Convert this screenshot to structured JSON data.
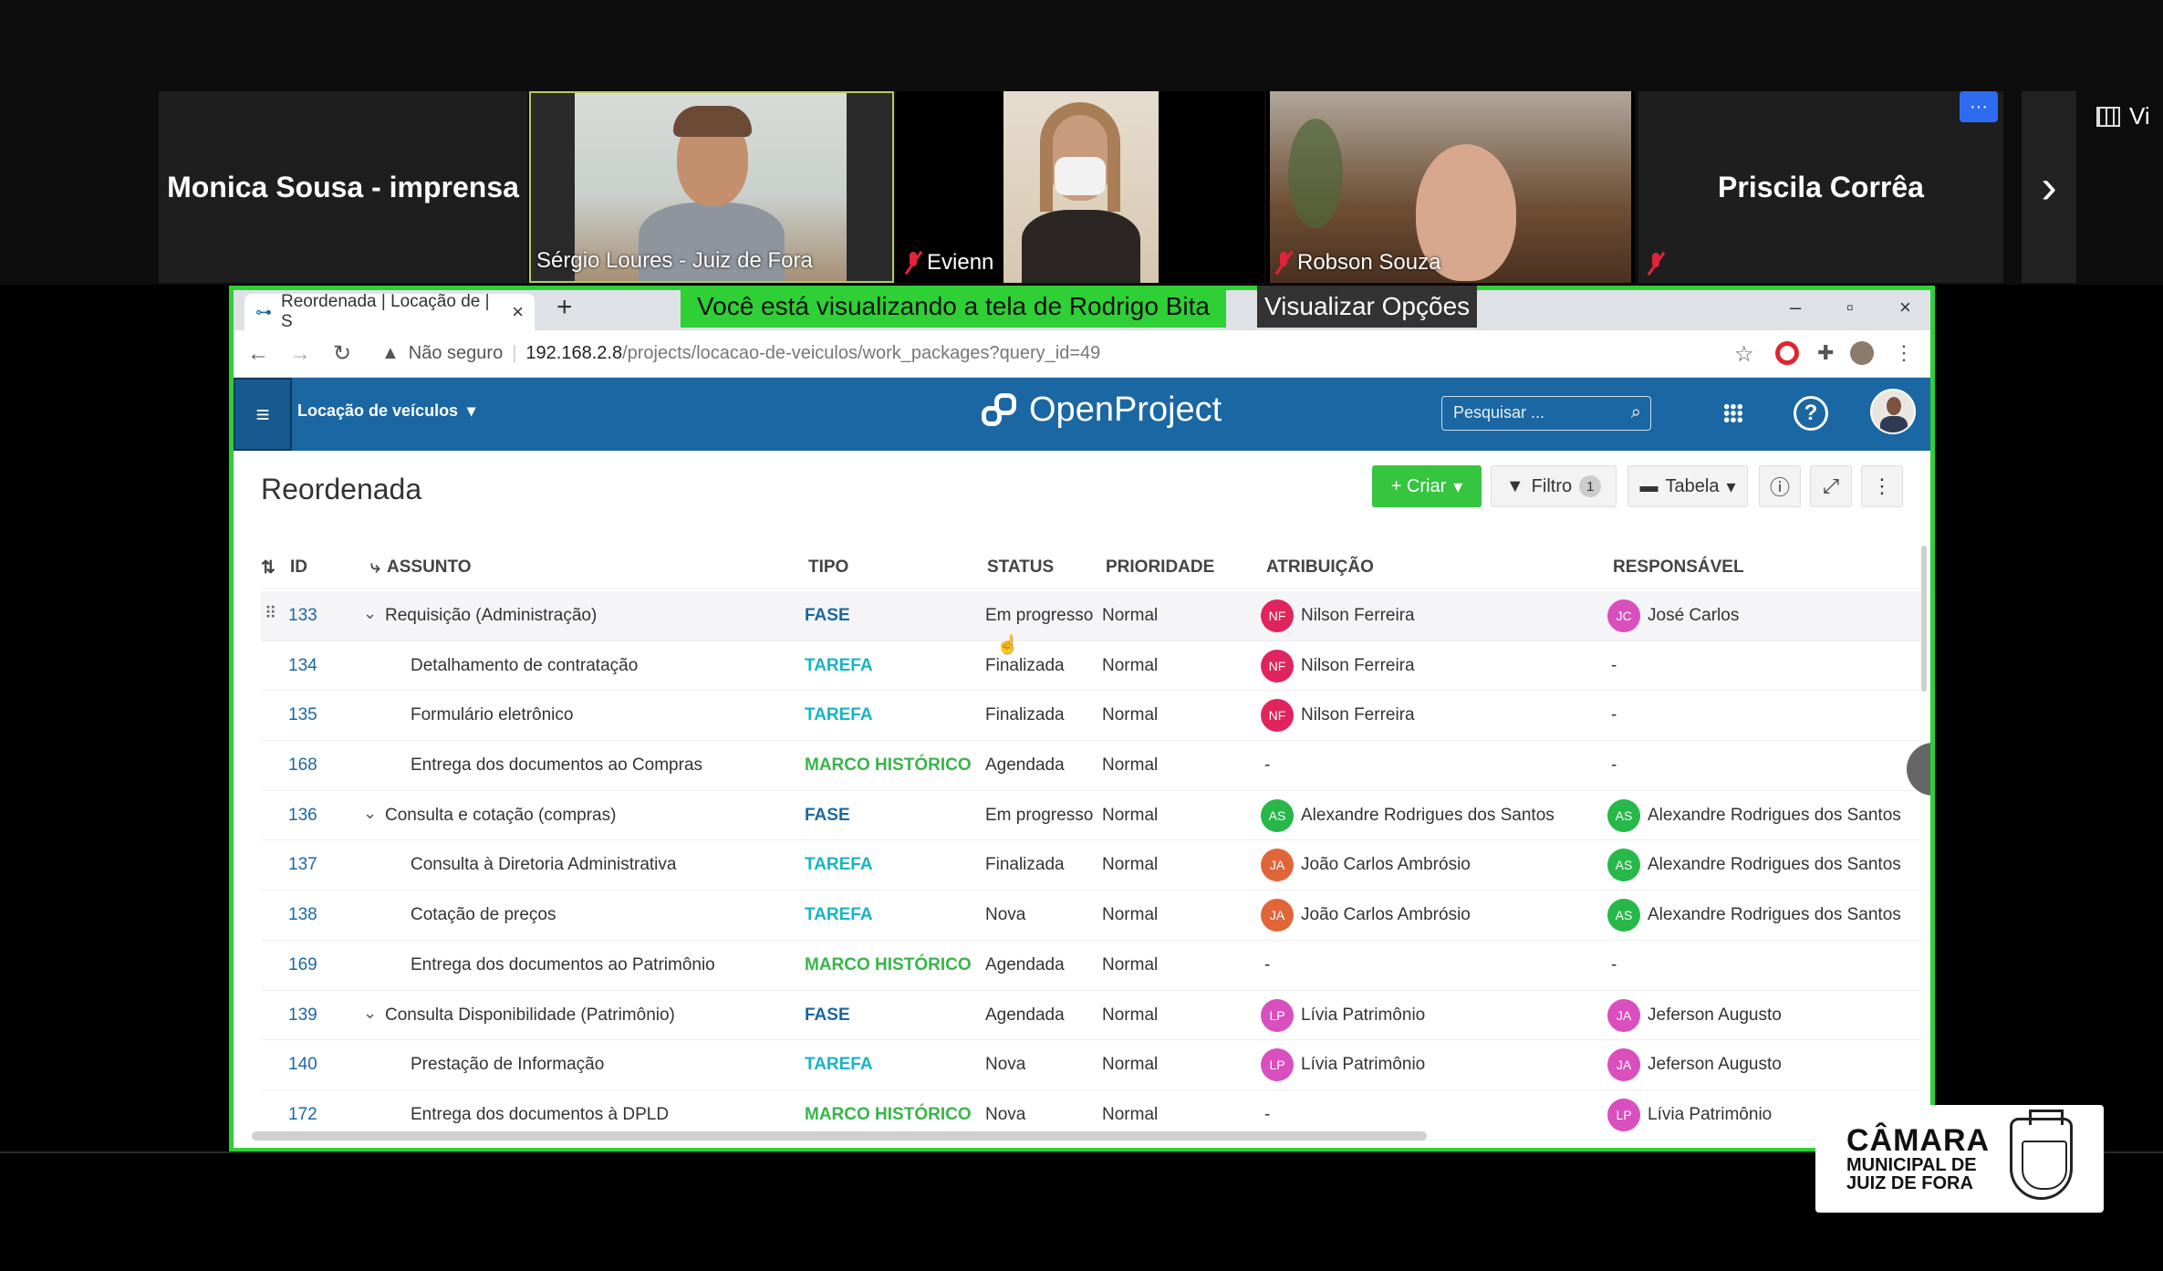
{
  "participants": [
    {
      "name": "Monica Sousa - imprensa",
      "video": false
    },
    {
      "name": "Sérgio Loures - Juiz de Fora",
      "video": true,
      "muted": false
    },
    {
      "name": "Evienn",
      "video": true,
      "muted": true
    },
    {
      "name": "Robson Souza",
      "video": true,
      "muted": true
    },
    {
      "name": "Priscila Corrêa",
      "video": false
    }
  ],
  "gallery": {
    "next_label": "›",
    "more_label": "···",
    "view_label": "Vi"
  },
  "share": {
    "banner": "Você está visualizando a tela de Rodrigo Bita",
    "options": "Visualizar Opções"
  },
  "browser": {
    "tab_title": "Reordenada | Locação de | S",
    "tab_close": "×",
    "new_tab": "+",
    "min": "–",
    "max": "▫",
    "close": "×",
    "security": "Não seguro",
    "url_host": "192.168.2.8",
    "url_path": "/projects/locacao-de-veiculos/work_packages?query_id=49"
  },
  "header": {
    "project": "Locação de veículos",
    "logo": "OpenProject",
    "search_placeholder": "Pesquisar ..."
  },
  "toolbar": {
    "title": "Reordenada",
    "create": "+ Criar",
    "filter": "Filtro",
    "filter_count": "1",
    "table": "Tabela"
  },
  "columns": {
    "id": "ID",
    "subject": "ASSUNTO",
    "type": "TIPO",
    "status": "STATUS",
    "priority": "PRIORIDADE",
    "assignee": "ATRIBUIÇÃO",
    "responsible": "RESPONSÁVEL"
  },
  "rows": [
    {
      "id": "133",
      "subject": "Requisição (Administração)",
      "parent": true,
      "type": "FASE",
      "status": "Em progresso",
      "priority": "Normal",
      "assignee": {
        "initials": "NF",
        "name": "Nilson Ferreira",
        "color": "#e0245e"
      },
      "responsible": {
        "initials": "JC",
        "name": "José Carlos",
        "color": "#d94fbe"
      }
    },
    {
      "id": "134",
      "subject": "Detalhamento de contratação",
      "parent": false,
      "type": "TAREFA",
      "status": "Finalizada",
      "priority": "Normal",
      "assignee": {
        "initials": "NF",
        "name": "Nilson Ferreira",
        "color": "#e0245e"
      },
      "responsible": null
    },
    {
      "id": "135",
      "subject": "Formulário eletrônico",
      "parent": false,
      "type": "TAREFA",
      "status": "Finalizada",
      "priority": "Normal",
      "assignee": {
        "initials": "NF",
        "name": "Nilson Ferreira",
        "color": "#e0245e"
      },
      "responsible": null
    },
    {
      "id": "168",
      "subject": "Entrega dos documentos ao Compras",
      "parent": false,
      "type": "MARCO HISTÓRICO",
      "status": "Agendada",
      "priority": "Normal",
      "assignee": null,
      "responsible": null
    },
    {
      "id": "136",
      "subject": "Consulta e cotação (compras)",
      "parent": true,
      "type": "FASE",
      "status": "Em progresso",
      "priority": "Normal",
      "assignee": {
        "initials": "AS",
        "name": "Alexandre Rodrigues dos Santos",
        "color": "#28b84a"
      },
      "responsible": {
        "initials": "AS",
        "name": "Alexandre Rodrigues dos Santos",
        "color": "#28b84a"
      }
    },
    {
      "id": "137",
      "subject": "Consulta à Diretoria Administrativa",
      "parent": false,
      "type": "TAREFA",
      "status": "Finalizada",
      "priority": "Normal",
      "assignee": {
        "initials": "JA",
        "name": "João Carlos Ambrósio",
        "color": "#e0663a"
      },
      "responsible": {
        "initials": "AS",
        "name": "Alexandre Rodrigues dos Santos",
        "color": "#28b84a"
      }
    },
    {
      "id": "138",
      "subject": "Cotação de preços",
      "parent": false,
      "type": "TAREFA",
      "status": "Nova",
      "priority": "Normal",
      "assignee": {
        "initials": "JA",
        "name": "João Carlos Ambrósio",
        "color": "#e0663a"
      },
      "responsible": {
        "initials": "AS",
        "name": "Alexandre Rodrigues dos Santos",
        "color": "#28b84a"
      }
    },
    {
      "id": "169",
      "subject": "Entrega dos documentos ao Patrimônio",
      "parent": false,
      "type": "MARCO HISTÓRICO",
      "status": "Agendada",
      "priority": "Normal",
      "assignee": null,
      "responsible": null
    },
    {
      "id": "139",
      "subject": "Consulta Disponibilidade (Patrimônio)",
      "parent": true,
      "type": "FASE",
      "status": "Agendada",
      "priority": "Normal",
      "assignee": {
        "initials": "LP",
        "name": "Lívia Patrimônio",
        "color": "#d94fbe"
      },
      "responsible": {
        "initials": "JA",
        "name": "Jeferson Augusto",
        "color": "#d94fbe"
      }
    },
    {
      "id": "140",
      "subject": "Prestação de Informação",
      "parent": false,
      "type": "TAREFA",
      "status": "Nova",
      "priority": "Normal",
      "assignee": {
        "initials": "LP",
        "name": "Lívia Patrimônio",
        "color": "#d94fbe"
      },
      "responsible": {
        "initials": "JA",
        "name": "Jeferson Augusto",
        "color": "#d94fbe"
      }
    },
    {
      "id": "172",
      "subject": "Entrega dos documentos à DPLD",
      "parent": false,
      "type": "MARCO HISTÓRICO",
      "status": "Nova",
      "priority": "Normal",
      "assignee": null,
      "responsible": {
        "initials": "LP",
        "name": "Lívia Patrimônio",
        "color": "#d94fbe"
      }
    }
  ],
  "empty_value": "-",
  "broadcaster": {
    "line1": "CÂMARA",
    "line2": "MUNICIPAL DE",
    "line3": "JUIZ DE FORA"
  }
}
